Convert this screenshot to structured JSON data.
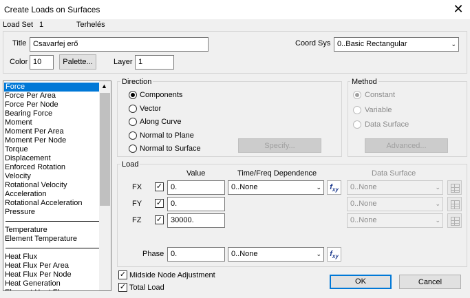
{
  "window": {
    "title": "Create Loads on Surfaces",
    "close_glyph": "✕"
  },
  "loadset": {
    "label": "Load Set",
    "number": "1",
    "name": "Terhelés"
  },
  "form": {
    "title_label": "Title",
    "title_value": "Csavarfej erő",
    "coordsys_label": "Coord Sys",
    "coordsys_value": "0..Basic Rectangular",
    "color_label": "Color",
    "color_value": "10",
    "palette_button": "Palette...",
    "layer_label": "Layer",
    "layer_value": "1"
  },
  "load_types": {
    "group1": [
      "Force",
      "Force Per Area",
      "Force Per Node",
      "Bearing Force",
      "Moment",
      "Moment Per Area",
      "Moment Per Node",
      "Torque",
      "Displacement",
      "Enforced Rotation",
      "Velocity",
      "Rotational Velocity",
      "Acceleration",
      "Rotational Acceleration",
      "Pressure"
    ],
    "group2": [
      "Temperature",
      "Element Temperature"
    ],
    "group3": [
      "Heat Flux",
      "Heat Flux Per Area",
      "Heat Flux Per Node",
      "Heat Generation",
      "Element Heat Flux"
    ],
    "selected": "Force"
  },
  "direction": {
    "label": "Direction",
    "options": [
      "Components",
      "Vector",
      "Along Curve",
      "Normal to Plane",
      "Normal to Surface"
    ],
    "selected": "Components",
    "specify_button": "Specify..."
  },
  "method": {
    "label": "Method",
    "options": [
      "Constant",
      "Variable",
      "Data Surface"
    ],
    "selected": "Constant",
    "advanced_button": "Advanced..."
  },
  "load": {
    "label": "Load",
    "col_value": "Value",
    "col_time": "Time/Freq Dependence",
    "col_data": "Data Surface",
    "rows": [
      {
        "name": "FX",
        "checked": true,
        "value": "0.",
        "time": "0..None",
        "data": "0..None"
      },
      {
        "name": "FY",
        "checked": true,
        "value": "0.",
        "data": "0..None"
      },
      {
        "name": "FZ",
        "checked": true,
        "value": "30000.",
        "data": "0..None"
      }
    ],
    "phase_label": "Phase",
    "phase_value": "0.",
    "phase_time": "0..None",
    "fxy_main": "f",
    "fxy_sub": "xy"
  },
  "options": {
    "midside": {
      "label": "Midside Node Adjustment",
      "checked": true
    },
    "total": {
      "label": "Total Load",
      "checked": true
    }
  },
  "buttons": {
    "ok": "OK",
    "cancel": "Cancel"
  },
  "glyphs": {
    "check": "✓",
    "dropdown": "⌄",
    "up": "▲"
  }
}
